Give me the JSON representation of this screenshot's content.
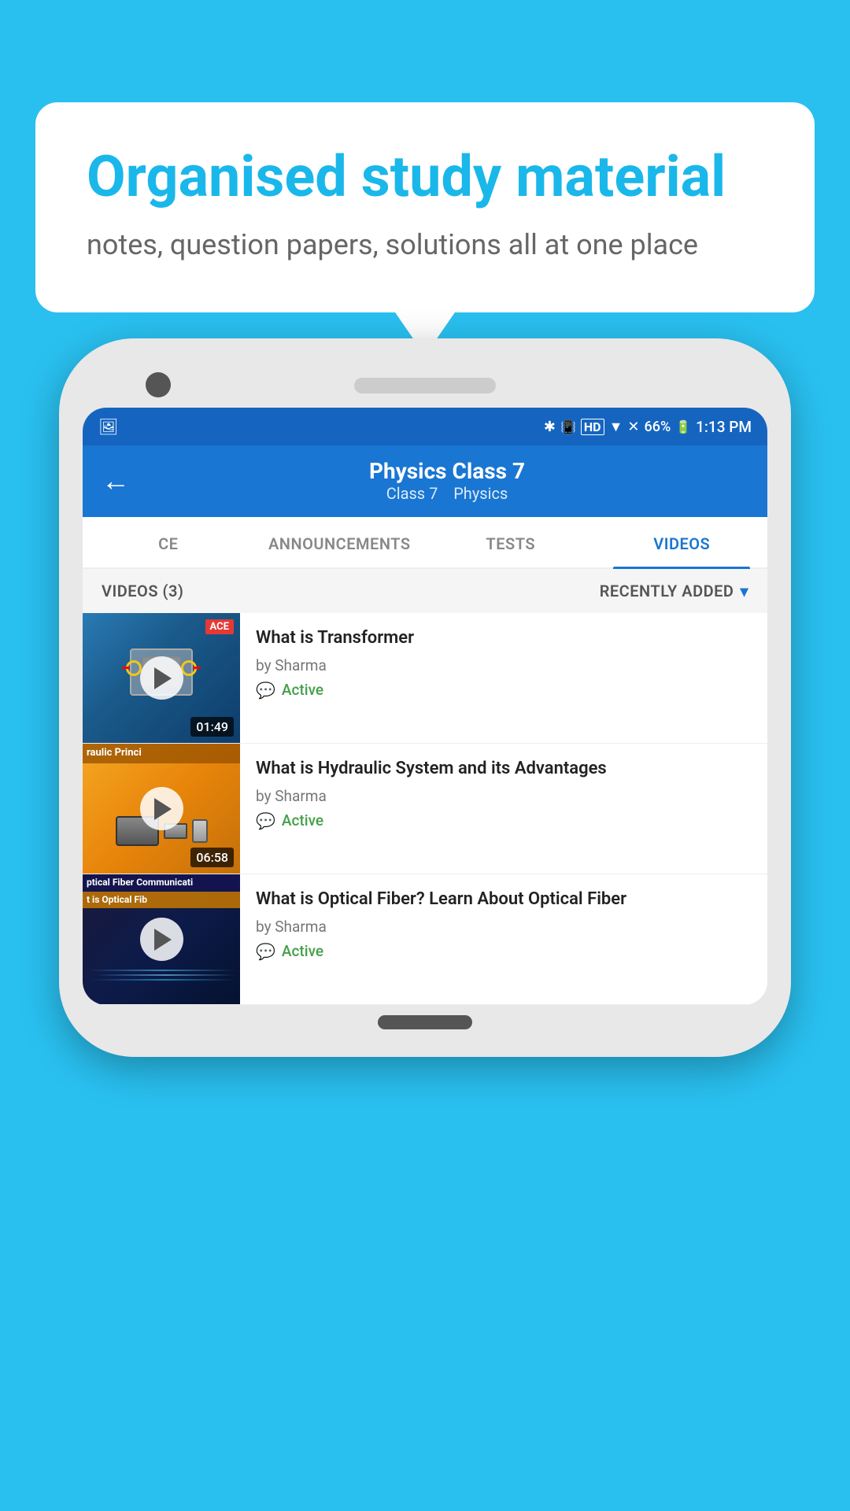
{
  "background_color": "#1ab7ea",
  "speech_bubble": {
    "heading": "Organised study material",
    "subtext": "notes, question papers, solutions all at one place"
  },
  "phone": {
    "status_bar": {
      "time": "1:13 PM",
      "battery": "66%",
      "signal_icons": "▲ HD ▼ ✕"
    },
    "app_bar": {
      "back_label": "←",
      "title": "Physics Class 7",
      "subtitle_class": "Class 7",
      "subtitle_subject": "Physics"
    },
    "tabs": [
      {
        "label": "CE",
        "active": false
      },
      {
        "label": "ANNOUNCEMENTS",
        "active": false
      },
      {
        "label": "TESTS",
        "active": false
      },
      {
        "label": "VIDEOS",
        "active": true
      }
    ],
    "filter_bar": {
      "count_label": "VIDEOS (3)",
      "sort_label": "RECENTLY ADDED",
      "chevron": "▾"
    },
    "videos": [
      {
        "title": "What is  Transformer",
        "author": "by Sharma",
        "status": "Active",
        "duration": "01:49",
        "thumbnail_type": "transformer",
        "thumbnail_text": "",
        "ace_badge": "ACE"
      },
      {
        "title": "What is Hydraulic System and its Advantages",
        "author": "by Sharma",
        "status": "Active",
        "duration": "06:58",
        "thumbnail_type": "hydraulic",
        "thumbnail_text": "raulic Princi",
        "ace_badge": ""
      },
      {
        "title": "What is Optical Fiber? Learn About Optical Fiber",
        "author": "by Sharma",
        "status": "Active",
        "duration": "",
        "thumbnail_type": "optical",
        "thumbnail_text": "ptical Fiber Communicati\nt is Optical Fib",
        "ace_badge": ""
      }
    ]
  }
}
